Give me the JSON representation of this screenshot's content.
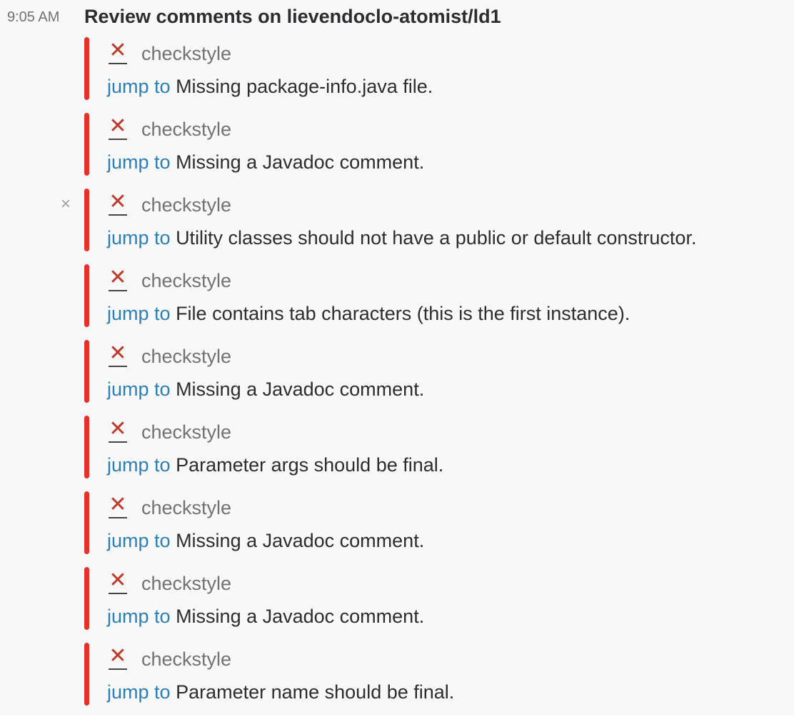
{
  "message": {
    "timestamp": "9:05 AM",
    "title": "Review comments on lievendoclo-atomist/ld1"
  },
  "colors": {
    "attachment_bar": "#e8302a",
    "error_x": "#c0392b",
    "link": "#2a80b9"
  },
  "attachments": [
    {
      "author": "checkstyle",
      "link_text": "jump to",
      "text": "Missing package-info.java file."
    },
    {
      "author": "checkstyle",
      "link_text": "jump to",
      "text": "Missing a Javadoc comment."
    },
    {
      "author": "checkstyle",
      "link_text": "jump to",
      "text": "Utility classes should not have a public or default constructor.",
      "dismiss": "×"
    },
    {
      "author": "checkstyle",
      "link_text": "jump to",
      "text": "File contains tab characters (this is the first instance)."
    },
    {
      "author": "checkstyle",
      "link_text": "jump to",
      "text": "Missing a Javadoc comment."
    },
    {
      "author": "checkstyle",
      "link_text": "jump to",
      "text": "Parameter args should be final."
    },
    {
      "author": "checkstyle",
      "link_text": "jump to",
      "text": "Missing a Javadoc comment."
    },
    {
      "author": "checkstyle",
      "link_text": "jump to",
      "text": "Missing a Javadoc comment."
    },
    {
      "author": "checkstyle",
      "link_text": "jump to",
      "text": "Parameter name should be final."
    }
  ]
}
